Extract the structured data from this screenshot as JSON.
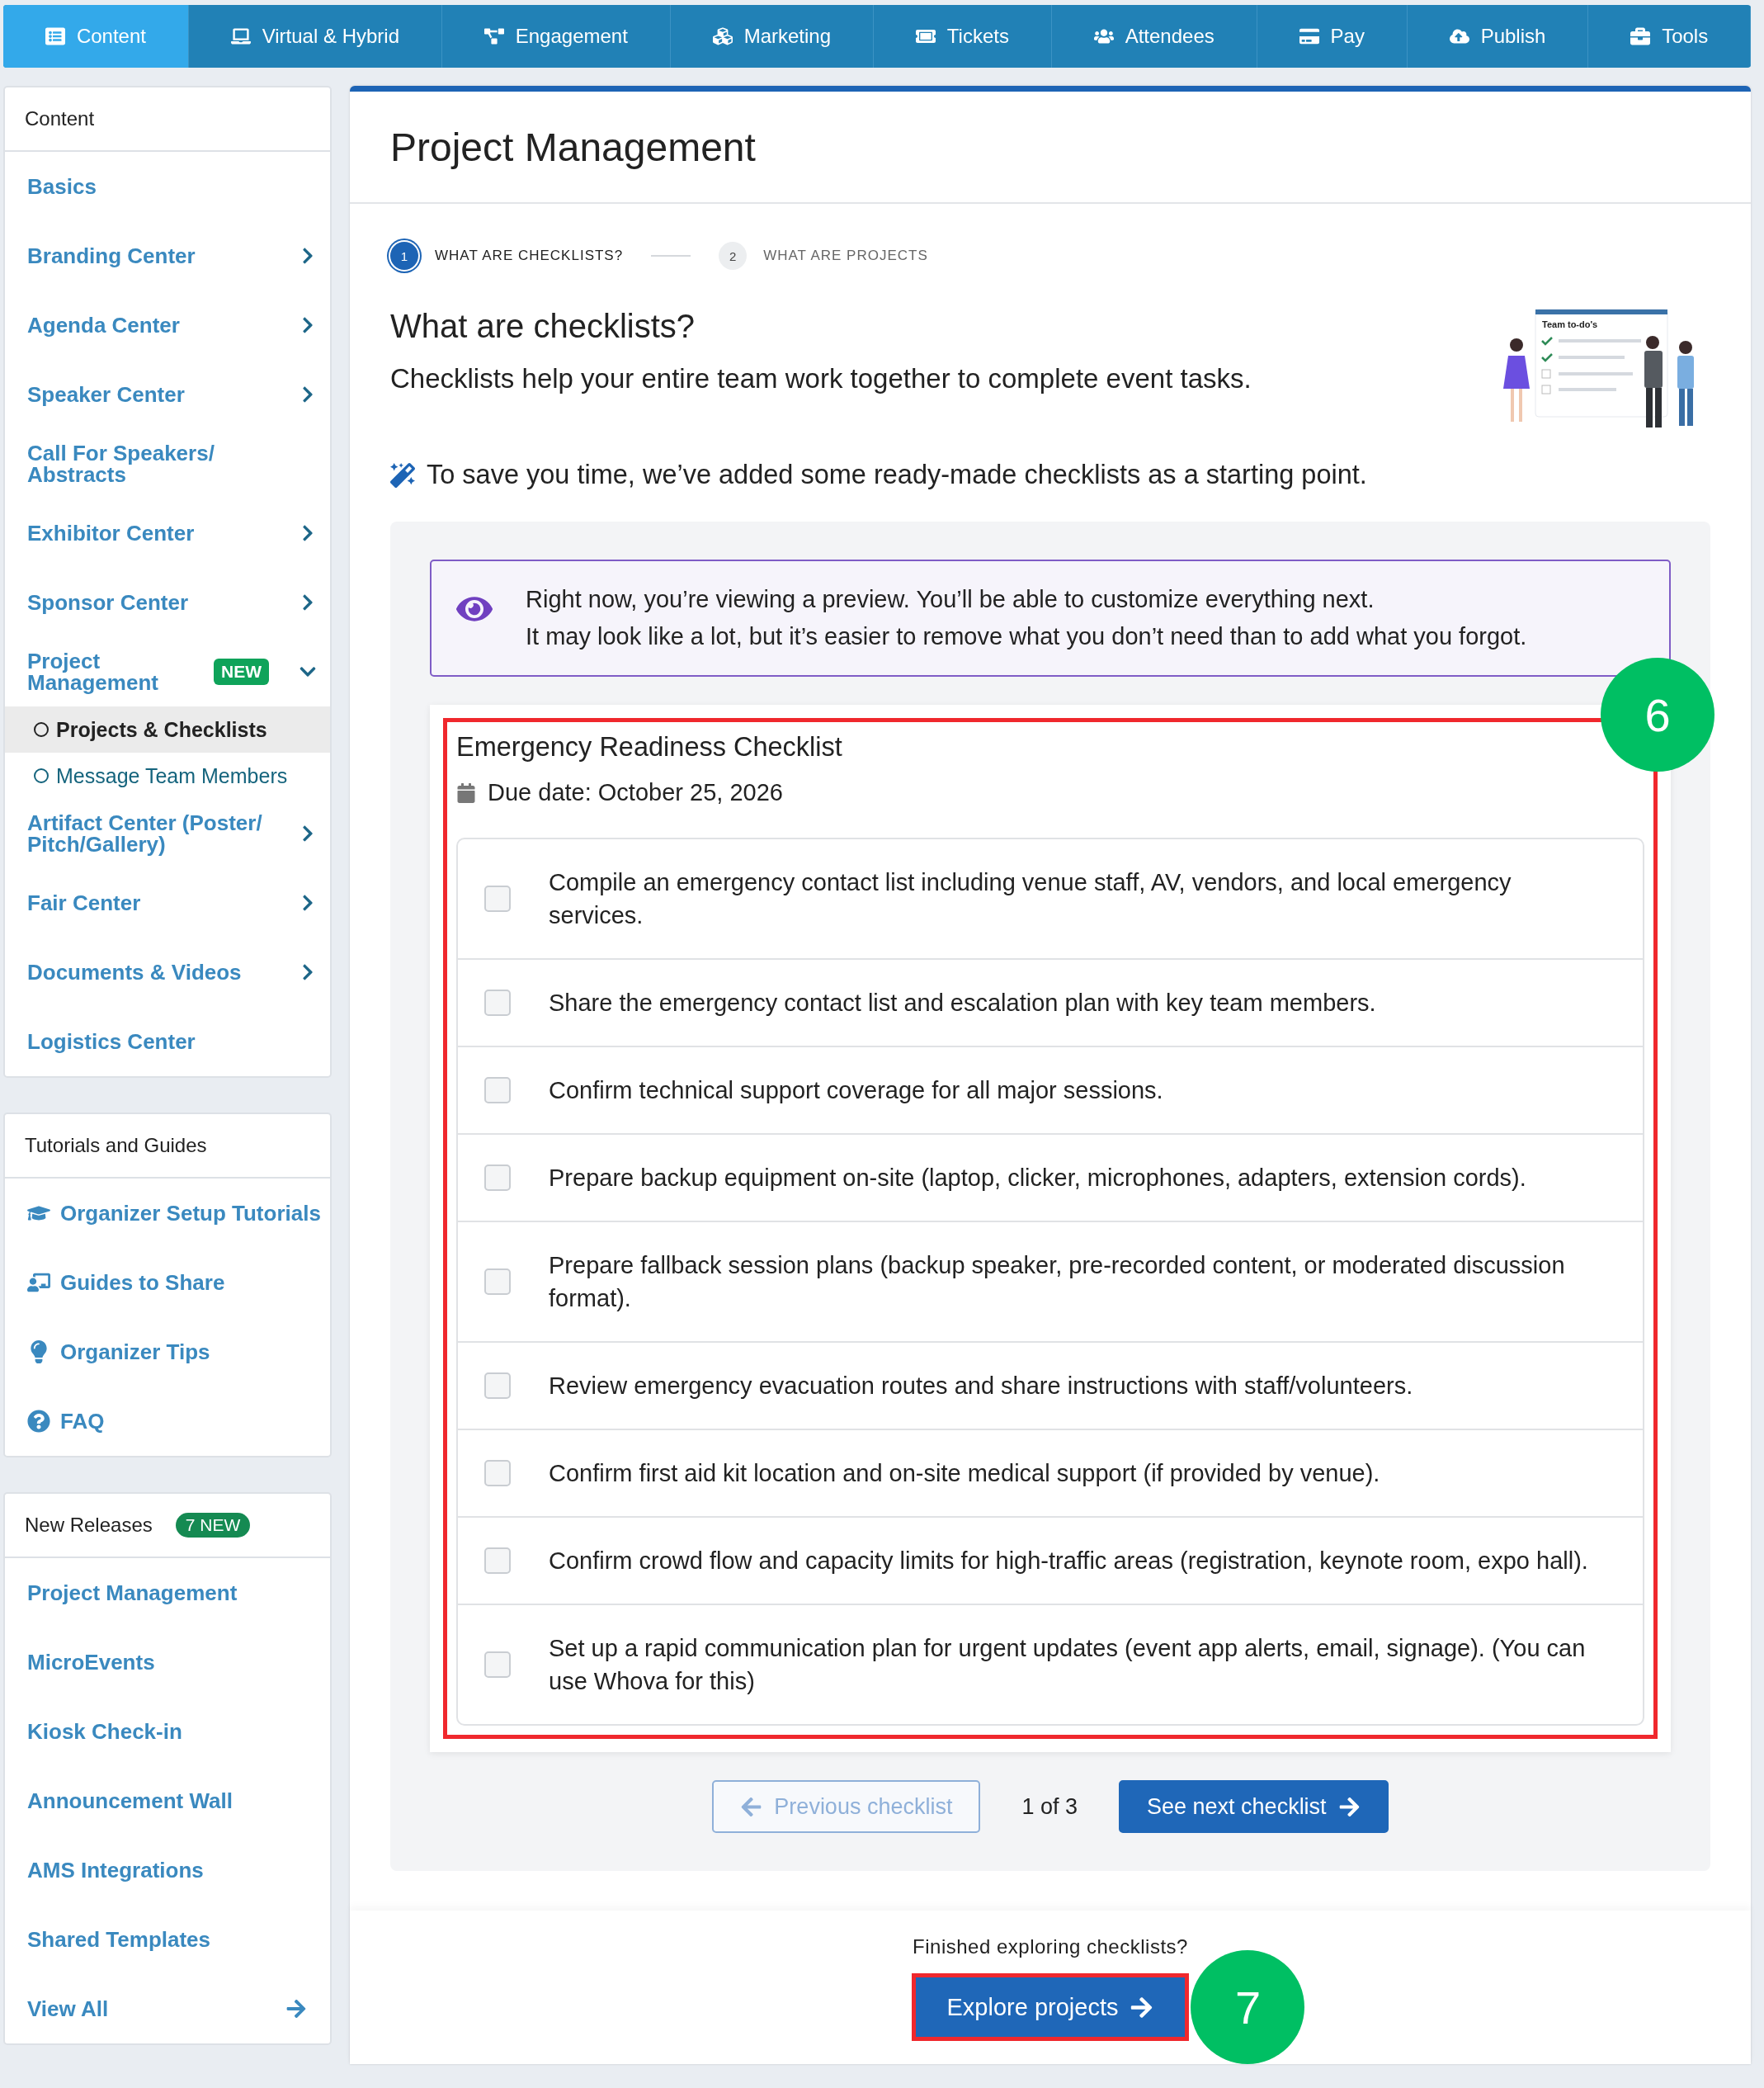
{
  "nav": {
    "tabs": [
      {
        "label": "Content",
        "selected": true
      },
      {
        "label": "Virtual & Hybrid",
        "selected": false
      },
      {
        "label": "Engagement",
        "selected": false
      },
      {
        "label": "Marketing",
        "selected": false
      },
      {
        "label": "Tickets",
        "selected": false
      },
      {
        "label": "Attendees",
        "selected": false
      },
      {
        "label": "Pay",
        "selected": false
      },
      {
        "label": "Publish",
        "selected": false
      },
      {
        "label": "Tools",
        "selected": false
      }
    ]
  },
  "sidebar": {
    "content": {
      "header": "Content",
      "items": [
        {
          "kind": "link",
          "label": "Basics"
        },
        {
          "kind": "group",
          "label": "Branding Center",
          "expanded": false
        },
        {
          "kind": "group",
          "label": "Agenda Center",
          "expanded": false
        },
        {
          "kind": "group",
          "label": "Speaker Center",
          "expanded": false
        },
        {
          "kind": "link",
          "label": "Call For Speakers/ Abstracts"
        },
        {
          "kind": "group",
          "label": "Exhibitor Center",
          "expanded": false
        },
        {
          "kind": "group",
          "label": "Sponsor Center",
          "expanded": false
        },
        {
          "kind": "group",
          "label": "Project Management",
          "badge": "NEW",
          "expanded": true,
          "children": [
            {
              "label": "Projects & Checklists",
              "selected": true
            },
            {
              "label": "Message Team Members",
              "selected": false
            }
          ]
        },
        {
          "kind": "group",
          "label": "Artifact Center (Poster/ Pitch/Gallery)",
          "expanded": false
        },
        {
          "kind": "group",
          "label": "Fair Center",
          "expanded": false
        },
        {
          "kind": "group",
          "label": "Documents & Videos",
          "expanded": false
        },
        {
          "kind": "link",
          "label": "Logistics Center"
        }
      ]
    },
    "tutorials": {
      "header": "Tutorials and Guides",
      "items": [
        "Organizer Setup Tutorials",
        "Guides to Share",
        "Organizer Tips",
        "FAQ"
      ]
    },
    "releases": {
      "header": "New Releases",
      "badge": "7 NEW",
      "items": [
        "Project Management",
        "MicroEvents",
        "Kiosk Check-in",
        "Announcement Wall",
        "AMS Integrations",
        "Shared Templates"
      ],
      "view_all": "View All"
    }
  },
  "main": {
    "title": "Project Management",
    "steps": [
      {
        "number": "1",
        "label": "WHAT ARE CHECKLISTS?",
        "selected": true
      },
      {
        "number": "2",
        "label": "WHAT ARE PROJECTS",
        "selected": false
      }
    ],
    "heading": "What are checklists?",
    "description": "Checklists help your entire team work together to complete event tasks.",
    "illustration": {
      "caption": "Team to-do's"
    },
    "tip": "To save you time, we’ve added some ready-made checklists as a starting point.",
    "notice": [
      "Right now, you’re viewing a preview. You’ll be able to customize everything next.",
      "It may look like a lot, but it’s easier to remove what you don’t need than to add what you forgot."
    ],
    "checklist": {
      "title": "Emergency Readiness Checklist",
      "due": "Due date: October 25, 2026",
      "highlighted": true,
      "callout": "6",
      "items": [
        {
          "text": "Compile an emergency contact list including venue staff, AV, vendors, and local emergency services.",
          "checked": false
        },
        {
          "text": "Share the emergency contact list and escalation plan with key team members.",
          "checked": false
        },
        {
          "text": "Confirm technical support coverage for all major sessions.",
          "checked": false
        },
        {
          "text": "Prepare backup equipment on-site (laptop, clicker, microphones, adapters, extension cords).",
          "checked": false
        },
        {
          "text": "Prepare fallback session plans (backup speaker, pre-recorded content, or moderated discussion format).",
          "checked": false
        },
        {
          "text": "Review emergency evacuation routes and share instructions with staff/volunteers.",
          "checked": false
        },
        {
          "text": "Confirm first aid kit location and on-site medical support (if provided by venue).",
          "checked": false
        },
        {
          "text": "Confirm crowd flow and capacity limits for high-traffic areas (registration, keynote room, expo hall).",
          "checked": false
        },
        {
          "text": "Set up a rapid communication plan for urgent updates (event app alerts, email, signage). (You can use Whova for this)",
          "checked": false
        }
      ]
    },
    "pagination": {
      "previous": {
        "label": "Previous checklist",
        "disabled": true
      },
      "counter": "1 of 3",
      "next": {
        "label": "See next checklist",
        "disabled": false
      }
    },
    "footer": {
      "prompt": "Finished exploring checklists?",
      "button": "Explore projects",
      "highlighted": true,
      "callout": "7"
    }
  }
}
